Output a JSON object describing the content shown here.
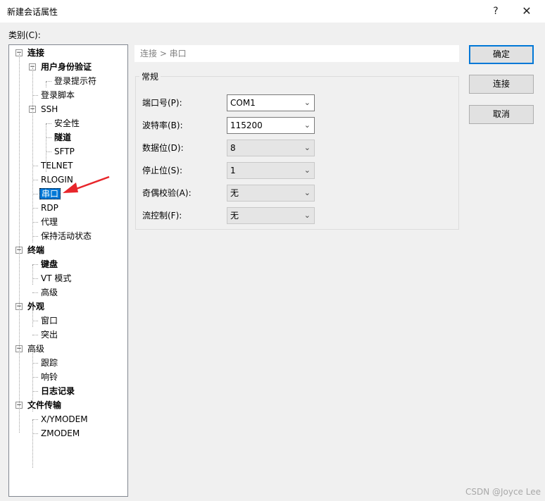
{
  "window": {
    "title": "新建会话属性",
    "help_glyph": "?",
    "close_glyph": "✕"
  },
  "category_label": "类别(C):",
  "tree": [
    {
      "label": "连接",
      "bold": true,
      "level": 0,
      "expander": "⊟",
      "name": "tree-connection"
    },
    {
      "label": "用户身份验证",
      "bold": true,
      "level": 1,
      "expander": "⊟",
      "name": "tree-user-auth"
    },
    {
      "label": "登录提示符",
      "bold": false,
      "level": 2,
      "expander": "",
      "name": "tree-login-prompts"
    },
    {
      "label": "登录脚本",
      "bold": false,
      "level": 1,
      "expander": "",
      "name": "tree-login-script"
    },
    {
      "label": "SSH",
      "bold": false,
      "level": 1,
      "expander": "⊟",
      "name": "tree-ssh"
    },
    {
      "label": "安全性",
      "bold": false,
      "level": 2,
      "expander": "",
      "name": "tree-security"
    },
    {
      "label": "隧道",
      "bold": true,
      "level": 2,
      "expander": "",
      "name": "tree-tunneling"
    },
    {
      "label": "SFTP",
      "bold": false,
      "level": 2,
      "expander": "",
      "name": "tree-sftp"
    },
    {
      "label": "TELNET",
      "bold": false,
      "level": 1,
      "expander": "",
      "name": "tree-telnet"
    },
    {
      "label": "RLOGIN",
      "bold": false,
      "level": 1,
      "expander": "",
      "name": "tree-rlogin"
    },
    {
      "label": "串口",
      "bold": false,
      "level": 1,
      "expander": "",
      "selected": true,
      "name": "tree-serial"
    },
    {
      "label": "RDP",
      "bold": false,
      "level": 1,
      "expander": "",
      "name": "tree-rdp"
    },
    {
      "label": "代理",
      "bold": false,
      "level": 1,
      "expander": "",
      "name": "tree-proxy"
    },
    {
      "label": "保持活动状态",
      "bold": false,
      "level": 1,
      "expander": "",
      "name": "tree-keepalive"
    },
    {
      "label": "终端",
      "bold": true,
      "level": 0,
      "expander": "⊟",
      "name": "tree-terminal"
    },
    {
      "label": "键盘",
      "bold": true,
      "level": 1,
      "expander": "",
      "name": "tree-keyboard"
    },
    {
      "label": "VT 模式",
      "bold": false,
      "level": 1,
      "expander": "",
      "name": "tree-vt-mode"
    },
    {
      "label": "高级",
      "bold": false,
      "level": 1,
      "expander": "",
      "name": "tree-terminal-advanced"
    },
    {
      "label": "外观",
      "bold": true,
      "level": 0,
      "expander": "⊟",
      "name": "tree-appearance"
    },
    {
      "label": "窗口",
      "bold": false,
      "level": 1,
      "expander": "",
      "name": "tree-window"
    },
    {
      "label": "突出",
      "bold": false,
      "level": 1,
      "expander": "",
      "name": "tree-highlight"
    },
    {
      "label": "高级",
      "bold": false,
      "level": 0,
      "expander": "⊟",
      "name": "tree-advanced"
    },
    {
      "label": "跟踪",
      "bold": false,
      "level": 1,
      "expander": "",
      "name": "tree-trace"
    },
    {
      "label": "响铃",
      "bold": false,
      "level": 1,
      "expander": "",
      "name": "tree-bell"
    },
    {
      "label": "日志记录",
      "bold": true,
      "level": 1,
      "expander": "",
      "name": "tree-logging"
    },
    {
      "label": "文件传输",
      "bold": true,
      "level": 0,
      "expander": "⊟",
      "name": "tree-file-transfer"
    },
    {
      "label": "X/YMODEM",
      "bold": false,
      "level": 1,
      "expander": "",
      "name": "tree-xymodem"
    },
    {
      "label": "ZMODEM",
      "bold": false,
      "level": 1,
      "expander": "",
      "name": "tree-zmodem"
    }
  ],
  "breadcrumb": "连接 > 串口",
  "group_title": "常规",
  "fields": [
    {
      "label": "端口号(P):",
      "value": "COM1",
      "enabled": true,
      "name": "port"
    },
    {
      "label": "波特率(B):",
      "value": "115200",
      "enabled": true,
      "name": "baud-rate"
    },
    {
      "label": "数据位(D):",
      "value": "8",
      "enabled": false,
      "name": "data-bits"
    },
    {
      "label": "停止位(S):",
      "value": "1",
      "enabled": false,
      "name": "stop-bits"
    },
    {
      "label": "奇偶校验(A):",
      "value": "无",
      "enabled": false,
      "name": "parity"
    },
    {
      "label": "流控制(F):",
      "value": "无",
      "enabled": false,
      "name": "flow-control"
    }
  ],
  "buttons": {
    "ok": "确定",
    "connect": "连接",
    "cancel": "取消"
  },
  "watermark": "CSDN @Joyce Lee",
  "colors": {
    "selection": "#0078d7",
    "arrow": "#e8262b"
  }
}
